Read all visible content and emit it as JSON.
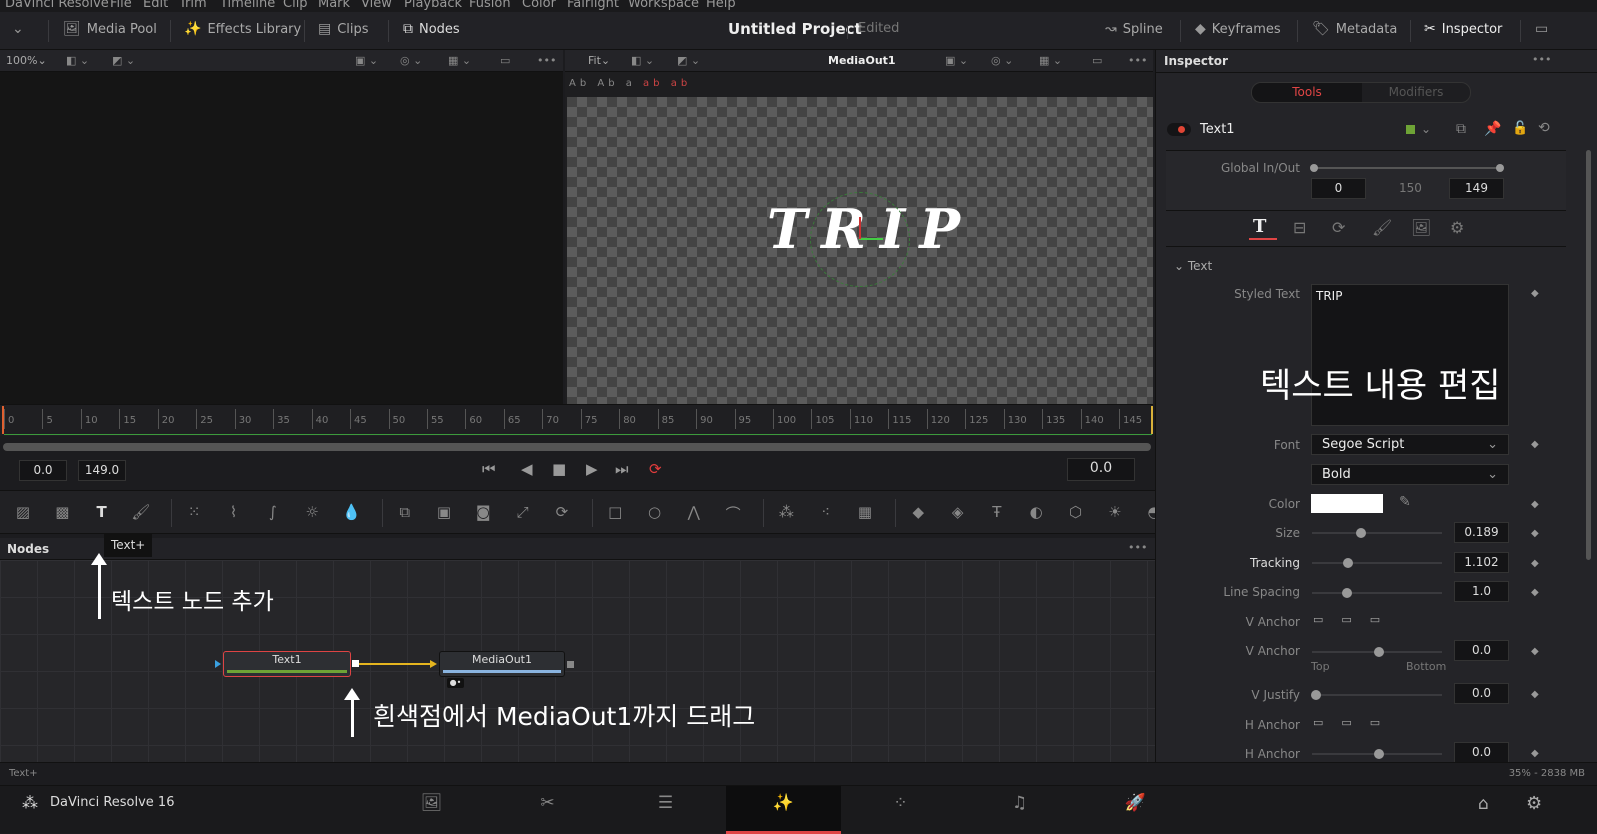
{
  "menu": [
    "DaVinci Resolve",
    "File",
    "Edit",
    "Trim",
    "Timeline",
    "Clip",
    "Mark",
    "View",
    "Playback",
    "Fusion",
    "Color",
    "Fairlight",
    "Workspace",
    "Help"
  ],
  "toolbar": {
    "media_pool": "Media Pool",
    "effects_library": "Effects Library",
    "clips": "Clips",
    "nodes": "Nodes",
    "project_title": "Untitled Project",
    "project_status": "Edited",
    "spline": "Spline",
    "keyframes": "Keyframes",
    "metadata": "Metadata",
    "inspector": "Inspector"
  },
  "viewer_left": {
    "zoom": "100%"
  },
  "viewer_right": {
    "zoom": "Fit",
    "title": "MediaOut1",
    "preview_text": "TRIP"
  },
  "timeline": {
    "ticks": [
      "0",
      "5",
      "10",
      "15",
      "20",
      "25",
      "30",
      "35",
      "40",
      "45",
      "50",
      "55",
      "60",
      "65",
      "70",
      "75",
      "80",
      "85",
      "90",
      "95",
      "100",
      "105",
      "110",
      "115",
      "120",
      "125",
      "130",
      "135",
      "140",
      "145"
    ],
    "start": "0.0",
    "end": "149.0",
    "current": "0.0"
  },
  "tools": [
    "background-icon",
    "fast-noise-icon",
    "text-plus-icon",
    "paint-icon",
    "particles-icon",
    "color-curves-icon",
    "color-corrector-icon",
    "brightness-icon",
    "blur-icon",
    "merge-icon",
    "matte-icon",
    "channel-boolean-icon",
    "resize-icon",
    "transform-icon",
    "rectangle-mask-icon",
    "ellipse-mask-icon",
    "polygon-mask-icon",
    "bspline-mask-icon",
    "p-emitter-icon",
    "p-render-icon",
    "p-merge-icon",
    "shape3d-icon",
    "merge3d-icon",
    "text3d-icon",
    "camera3d-icon",
    "render3d-icon",
    "light3d-icon",
    "ambient-light-icon"
  ],
  "tooltip": "Text+",
  "nodes_panel": {
    "title": "Nodes",
    "node1": "Text1",
    "node2": "MediaOut1"
  },
  "annotations": {
    "add_text_node": "텍스트 노드 추가",
    "drag_hint": "흰색점에서 MediaOut1까지 드래그",
    "edit_text": "텍스트 내용 편집"
  },
  "status": {
    "left": "Text+",
    "right": "35% - 2838 MB"
  },
  "bottom": {
    "app": "DaVinci Resolve 16"
  },
  "inspector": {
    "title": "Inspector",
    "tab_tools": "Tools",
    "tab_modifiers": "Modifiers",
    "node_name": "Text1",
    "global_label": "Global In/Out",
    "global_in": "0",
    "global_mid": "150",
    "global_out": "149",
    "section": "Text",
    "styled_text_label": "Styled Text",
    "styled_text": "TRIP",
    "font_label": "Font",
    "font": "Segoe Script",
    "style": "Bold",
    "color_label": "Color",
    "color_value": "#ffffff",
    "size_label": "Size",
    "size": "0.189",
    "size_frac": 0.38,
    "tracking_label": "Tracking",
    "tracking": "1.102",
    "tracking_frac": 0.28,
    "line_spacing_label": "Line Spacing",
    "line_spacing": "1.0",
    "line_spacing_frac": 0.27,
    "vanchor_label": "V Anchor",
    "vanchor_val": "0.0",
    "top_label": "Top",
    "bottom_label": "Bottom",
    "vjustify_label": "V Justify",
    "vjustify_val": "0.0",
    "hanchor_label": "H Anchor",
    "hanchor_val": "0.0"
  },
  "colors": {
    "accent": "#e03c3c",
    "node_green": "#6ea336",
    "connection": "#e5b51f"
  }
}
